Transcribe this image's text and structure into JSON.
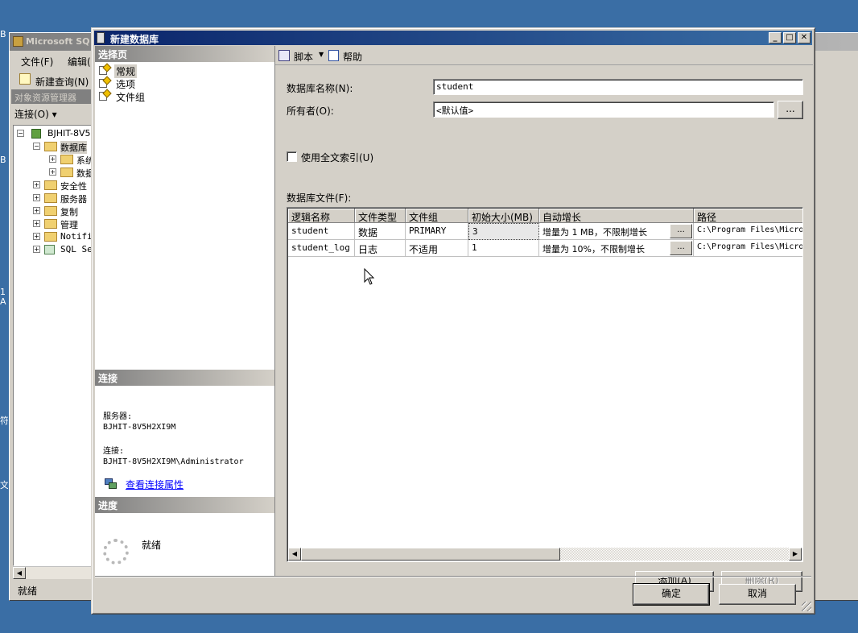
{
  "background_window": {
    "title": "Microsoft SQ",
    "menu": [
      "文件(F)",
      "编辑("
    ],
    "toolbar": {
      "new_query": "新建查询(N)"
    },
    "object_explorer": {
      "title": "对象资源管理器",
      "connect": "连接(O) ▾",
      "tree": [
        {
          "label": "BJHIT-8V5",
          "icon": "server-icon",
          "expander": "−",
          "level": 0
        },
        {
          "label": "数据库",
          "icon": "folder-icon",
          "expander": "−",
          "level": 1
        },
        {
          "label": "系统",
          "icon": "folder-icon",
          "expander": "+",
          "level": 2
        },
        {
          "label": "数据",
          "icon": "folder-icon",
          "expander": "+",
          "level": 2
        },
        {
          "label": "安全性",
          "icon": "folder-icon",
          "expander": "+",
          "level": 1
        },
        {
          "label": "服务器",
          "icon": "folder-icon",
          "expander": "+",
          "level": 1
        },
        {
          "label": "复制",
          "icon": "folder-icon",
          "expander": "+",
          "level": 1
        },
        {
          "label": "管理",
          "icon": "folder-icon",
          "expander": "+",
          "level": 1
        },
        {
          "label": "Notifi",
          "icon": "folder-icon",
          "expander": "+",
          "level": 1
        },
        {
          "label": "SQL Se",
          "icon": "sql-agent-icon",
          "expander": "+",
          "level": 1
        }
      ]
    },
    "status": "就绪"
  },
  "dialog": {
    "title": "新建数据库",
    "caption_buttons": {
      "minimize": "_",
      "maximize": "□",
      "close": "✕"
    },
    "select_page": {
      "header": "选择页",
      "items": [
        "常规",
        "选项",
        "文件组"
      ],
      "selected_index": 0
    },
    "connection": {
      "header": "连接",
      "server_label": "服务器:",
      "server_value": "BJHIT-8V5H2XI9M",
      "connection_label": "连接:",
      "connection_value": "BJHIT-8V5H2XI9M\\Administrator",
      "link": "查看连接属性"
    },
    "progress": {
      "header": "进度",
      "status": "就绪"
    },
    "toolbar": {
      "script": "脚本",
      "help": "帮助"
    },
    "form": {
      "db_name_label": "数据库名称(N):",
      "db_name_value": "student",
      "owner_label": "所有者(O):",
      "owner_value": "<默认值>",
      "browse_label": "...",
      "fulltext_label": "使用全文索引(U)",
      "fulltext_checked": false,
      "files_label": "数据库文件(F):"
    },
    "grid": {
      "columns": [
        "逻辑名称",
        "文件类型",
        "文件组",
        "初始大小(MB)",
        "自动增长",
        "路径"
      ],
      "rows": [
        [
          "student",
          "数据",
          "PRIMARY",
          "3",
          "增量为 1 MB，不限制增长",
          "C:\\Program Files\\Micro"
        ],
        [
          "student_log",
          "日志",
          "不适用",
          "1",
          "增量为 10%，不限制增长",
          "C:\\Program Files\\Micro"
        ]
      ],
      "cell_button": "...",
      "scroll_left": "◀",
      "scroll_right": "▶"
    },
    "buttons": {
      "add": "添加(A)",
      "remove": "删除(R)",
      "ok": "确定",
      "cancel": "取消"
    }
  },
  "desktop_glyphs": [
    "B",
    "B",
    "1",
    "A",
    "符",
    "文"
  ]
}
